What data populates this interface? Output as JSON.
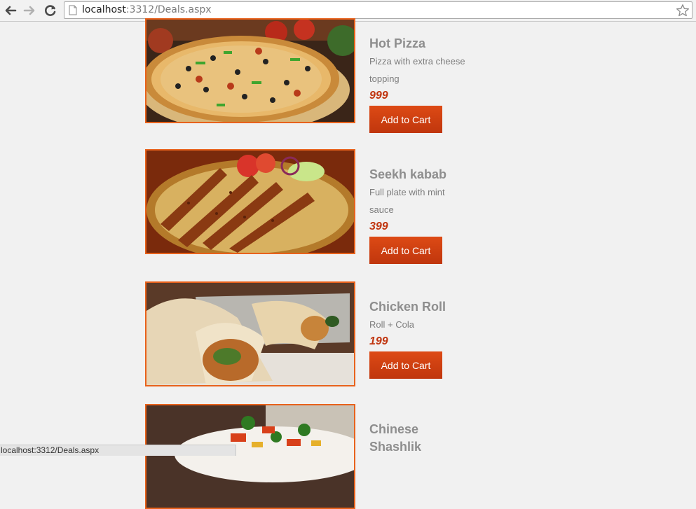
{
  "browser": {
    "url_host": "localhost",
    "url_path": ":3312/Deals.aspx",
    "status_text": "localhost:3312/Deals.aspx"
  },
  "deals": [
    {
      "name": "Hot Pizza",
      "description": "Pizza with extra cheese topping",
      "price": "999",
      "button": "Add to Cart",
      "image": "pizza-image"
    },
    {
      "name": "Seekh kabab",
      "description": "Full plate with mint sauce",
      "price": "399",
      "button": "Add to Cart",
      "image": "kabab-image"
    },
    {
      "name": "Chicken Roll",
      "description": "Roll + Cola",
      "price": "199",
      "button": "Add to Cart",
      "image": "chicken-roll-image"
    },
    {
      "name": "Chinese Shashlik",
      "image": "shashlik-image"
    }
  ],
  "colors": {
    "accent": "#e8621c",
    "button": "#cf3f10",
    "price": "#c0340e",
    "name": "#8e8e8e"
  }
}
